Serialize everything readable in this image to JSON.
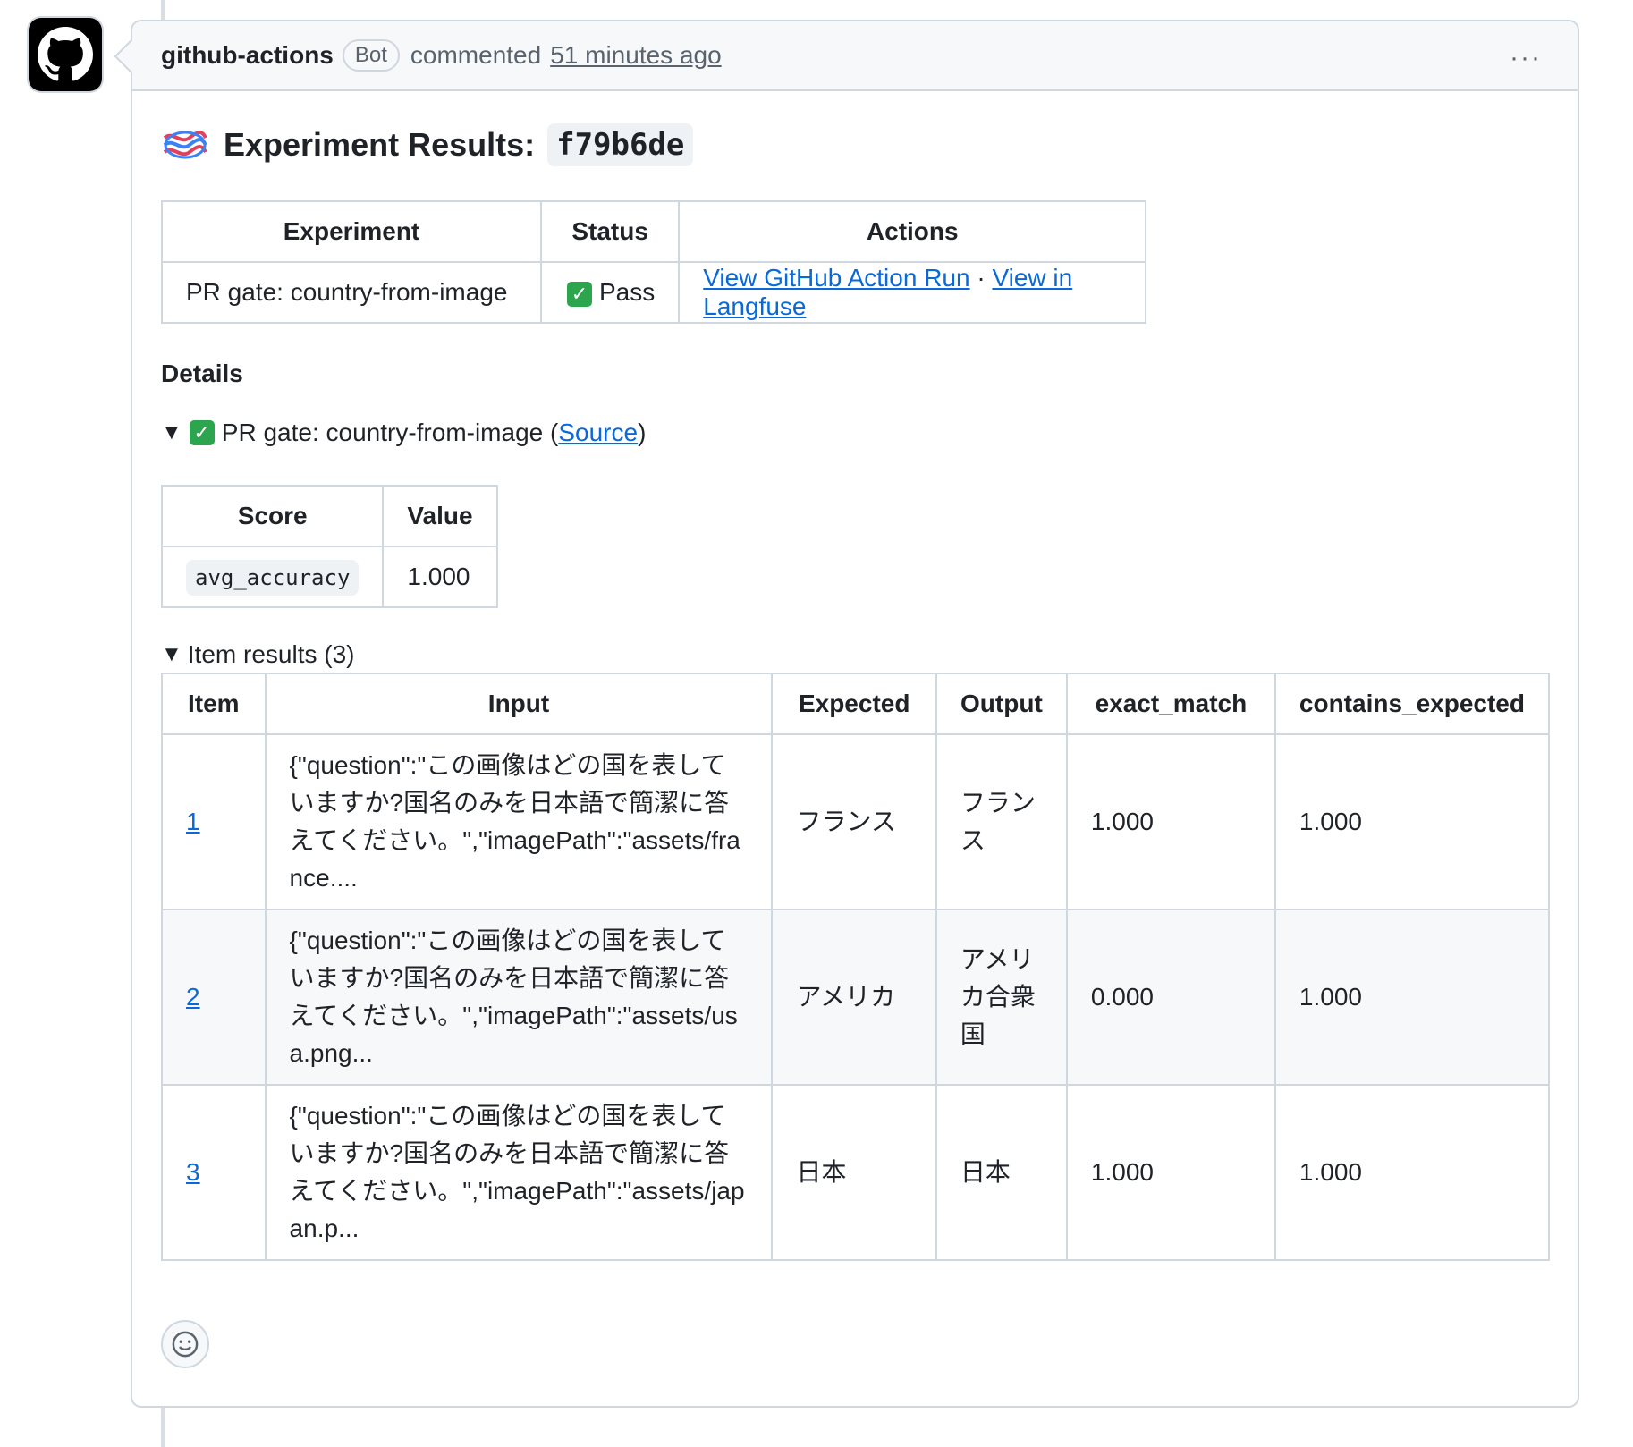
{
  "comment": {
    "author": "github-actions",
    "badge": "Bot",
    "action": "commented",
    "time": "51 minutes ago",
    "menu": "···"
  },
  "report": {
    "title_prefix": "Experiment Results:",
    "commit": "f79b6de",
    "summary_table": {
      "headers": [
        "Experiment",
        "Status",
        "Actions"
      ],
      "experiment": "PR gate: country-from-image",
      "status": "Pass",
      "action_run_link": "View GitHub Action Run",
      "separator": "·",
      "langfuse_link": "View in Langfuse"
    },
    "details_heading": "Details",
    "details_summary": {
      "label": "PR gate: country-from-image (",
      "source_link": "Source",
      "close": ")"
    },
    "score_table": {
      "headers": [
        "Score",
        "Value"
      ],
      "score_name": "avg_accuracy",
      "score_value": "1.000"
    },
    "item_results_label": "Item results (3)",
    "item_table": {
      "headers": [
        "Item",
        "Input",
        "Expected",
        "Output",
        "exact_match",
        "contains_expected"
      ],
      "rows": [
        {
          "item": "1",
          "input": "{\"question\":\"この画像はどの国を表していますか?国名のみを日本語で簡潔に答えてください。\",\"imagePath\":\"assets/france....",
          "expected": "フランス",
          "output": "フランス",
          "exact_match": "1.000",
          "contains_expected": "1.000"
        },
        {
          "item": "2",
          "input": "{\"question\":\"この画像はどの国を表していますか?国名のみを日本語で簡潔に答えてください。\",\"imagePath\":\"assets/usa.png...",
          "expected": "アメリカ",
          "output": "アメリカ合衆国",
          "exact_match": "0.000",
          "contains_expected": "1.000"
        },
        {
          "item": "3",
          "input": "{\"question\":\"この画像はどの国を表していますか?国名のみを日本語で簡潔に答えてください。\",\"imagePath\":\"assets/japan.p...",
          "expected": "日本",
          "output": "日本",
          "exact_match": "1.000",
          "contains_expected": "1.000"
        }
      ]
    }
  },
  "colors": {
    "link": "#0969da",
    "pass": "#2da44e",
    "border": "#d0d7de"
  },
  "icons": [
    "github-logo-icon",
    "langfuse-logo-icon",
    "check-icon",
    "triangle-down-icon",
    "smiley-icon",
    "kebab-icon"
  ]
}
